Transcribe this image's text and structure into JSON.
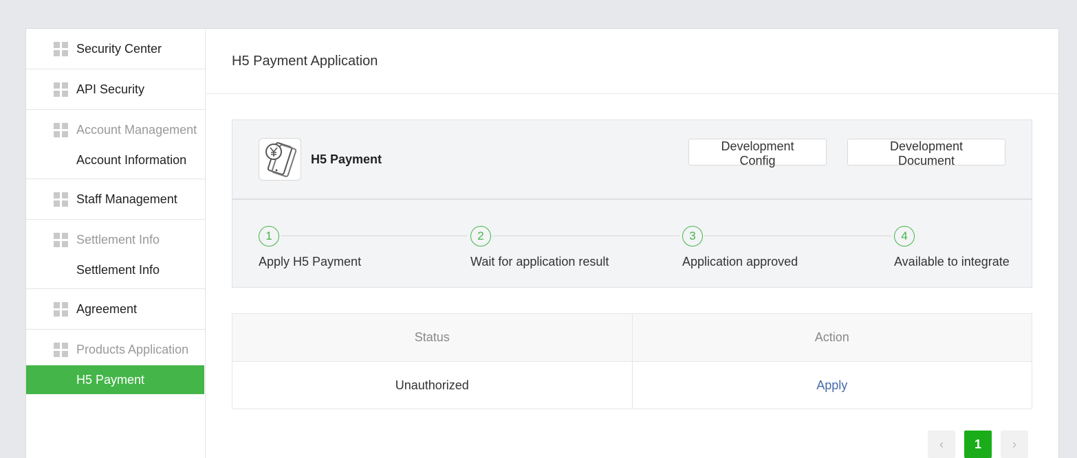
{
  "sidebar": {
    "groups": [
      {
        "label": "Security Center"
      },
      {
        "label": "API Security"
      },
      {
        "label": "Account Management",
        "sub": "Account Information"
      },
      {
        "label": "Staff Management"
      },
      {
        "label": "Settlement Info",
        "sub": "Settlement Info"
      },
      {
        "label": "Agreement"
      },
      {
        "label": "Products Application",
        "sub": "H5 Payment"
      }
    ],
    "active_item": "H5 Payment"
  },
  "page": {
    "title": "H5 Payment Application"
  },
  "product": {
    "name": "H5 Payment",
    "icon": "phone-yuan-icon",
    "buttons": {
      "config": "Development Config",
      "document": "Development Document"
    }
  },
  "steps": [
    {
      "num": "1",
      "label": "Apply H5 Payment"
    },
    {
      "num": "2",
      "label": "Wait for application result"
    },
    {
      "num": "3",
      "label": "Application approved"
    },
    {
      "num": "4",
      "label": "Available to integrate"
    }
  ],
  "table": {
    "headers": [
      "Status",
      "Action"
    ],
    "rows": [
      {
        "status": "Unauthorized",
        "action": "Apply"
      }
    ]
  },
  "pagination": {
    "prev": "‹",
    "current": "1",
    "next": "›"
  },
  "colors": {
    "accent": "#44b549",
    "link": "#466ca8",
    "page_bg": "#e7e8eb"
  }
}
